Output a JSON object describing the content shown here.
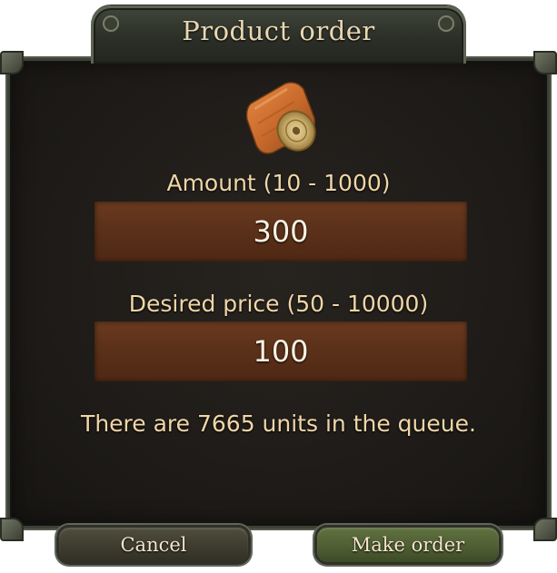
{
  "dialog": {
    "title": "Product order",
    "item_icon": "wood-log-icon"
  },
  "amount": {
    "label": "Amount (10 - 1000)",
    "value": "300"
  },
  "price": {
    "label": "Desired price (50 - 10000)",
    "value": "100"
  },
  "queue": {
    "text": "There are 7665 units in the queue."
  },
  "buttons": {
    "cancel": "Cancel",
    "make_order": "Make order"
  },
  "colors": {
    "label_text": "#f1d6a7",
    "field_bg": "#5a3019",
    "panel_bg": "#1e1b18",
    "cancel_button": "#3e3c2f",
    "make_order_button": "#4f5f33"
  }
}
